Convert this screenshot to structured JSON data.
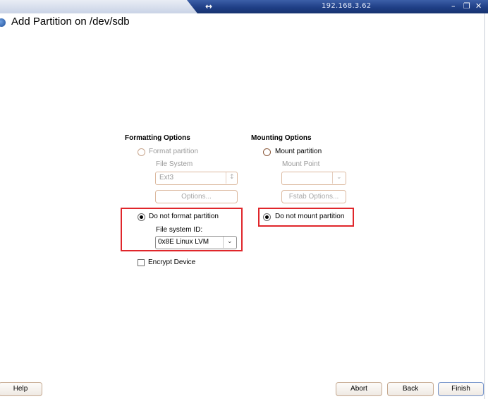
{
  "window": {
    "ip_address": "192.168.3.62"
  },
  "page": {
    "title": "Add Partition on /dev/sdb"
  },
  "formatting": {
    "section_title": "Formatting Options",
    "format_partition_label": "Format partition",
    "file_system_label": "File System",
    "file_system_value": "Ext3",
    "options_button": "Options...",
    "do_not_format_label": "Do not format partition",
    "file_system_id_label": "File system ID:",
    "file_system_id_value": "0x8E Linux LVM",
    "encrypt_device_label": "Encrypt Device"
  },
  "mounting": {
    "section_title": "Mounting Options",
    "mount_partition_label": "Mount partition",
    "mount_point_label": "Mount Point",
    "mount_point_value": "",
    "fstab_options_button": "Fstab Options...",
    "do_not_mount_label": "Do not mount partition"
  },
  "buttons": {
    "help": "Help",
    "abort": "Abort",
    "back": "Back",
    "finish": "Finish"
  },
  "colors": {
    "highlight": "#e0262b",
    "titlebar": "#1f3f86"
  }
}
